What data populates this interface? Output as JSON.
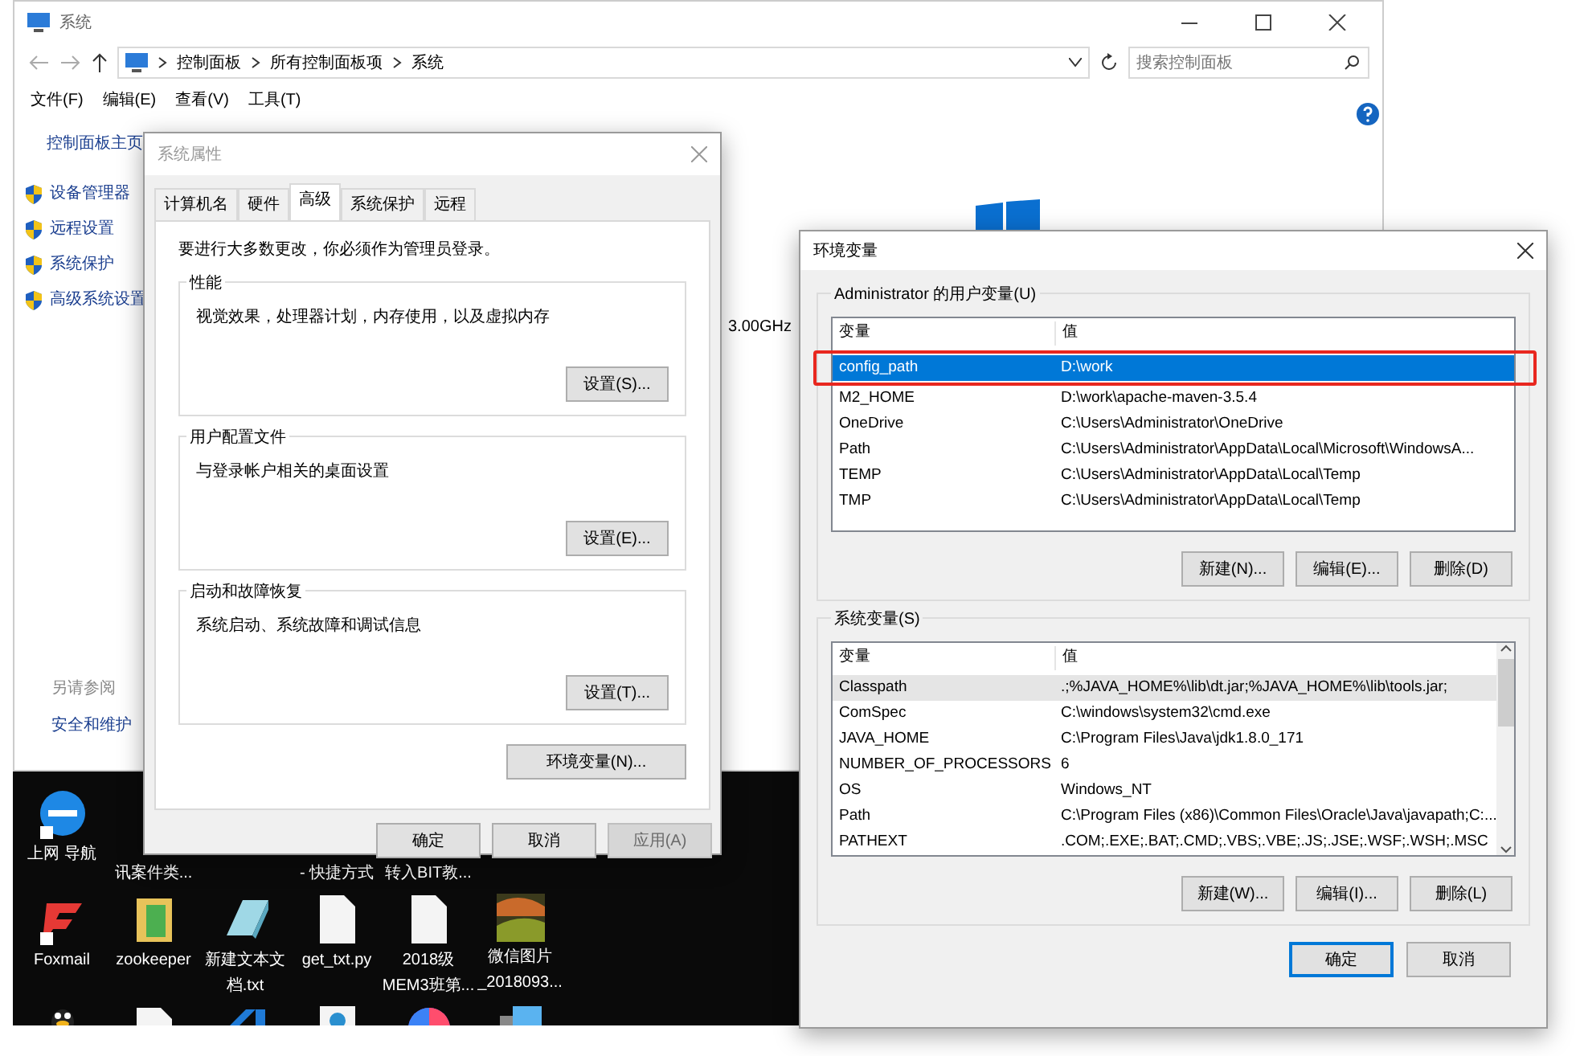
{
  "explorer": {
    "title": "系统",
    "breadcrumb": [
      "控制面板",
      "所有控制面板项",
      "系统"
    ],
    "search": {
      "placeholder": "搜索控制面板"
    },
    "menu": [
      "文件(F)",
      "编辑(E)",
      "查看(V)",
      "工具(T)"
    ],
    "sidebar": {
      "home": "控制面板主页",
      "links": [
        "设备管理器",
        "远程设置",
        "系统保护",
        "高级系统设置"
      ],
      "see_also": "另请参阅",
      "see_also_links": [
        "安全和维护"
      ]
    },
    "fragment": "3.00GHz"
  },
  "system_properties": {
    "title": "系统属性",
    "tabs": [
      {
        "label": "计算机名",
        "selected": false
      },
      {
        "label": "硬件",
        "selected": false
      },
      {
        "label": "高级",
        "selected": true
      },
      {
        "label": "系统保护",
        "selected": false
      },
      {
        "label": "远程",
        "selected": false
      }
    ],
    "notice": "要进行大多数更改，你必须作为管理员登录。",
    "groups": [
      {
        "title": "性能",
        "description": "视觉效果，处理器计划，内存使用，以及虚拟内存",
        "button": "设置(S)..."
      },
      {
        "title": "用户配置文件",
        "description": "与登录帐户相关的桌面设置",
        "button": "设置(E)..."
      },
      {
        "title": "启动和故障恢复",
        "description": "系统启动、系统故障和调试信息",
        "button": "设置(T)..."
      }
    ],
    "env_button": "环境变量(N)...",
    "buttons": [
      {
        "label": "确定",
        "disabled": false
      },
      {
        "label": "取消",
        "disabled": false
      },
      {
        "label": "应用(A)",
        "disabled": true
      }
    ]
  },
  "env_vars": {
    "title": "环境变量",
    "sections": [
      {
        "title": "Administrator 的用户变量(U)",
        "columns": [
          "变量",
          "值"
        ],
        "scrollbar": false,
        "rows": [
          {
            "name": "config_path",
            "value": "D:\\work",
            "selected": true,
            "hovered": false,
            "outlined": true
          },
          {
            "name": "M2_HOME",
            "value": "D:\\work\\apache-maven-3.5.4",
            "selected": false,
            "hovered": false,
            "outlined": false
          },
          {
            "name": "OneDrive",
            "value": "C:\\Users\\Administrator\\OneDrive",
            "selected": false,
            "hovered": false,
            "outlined": false
          },
          {
            "name": "Path",
            "value": "C:\\Users\\Administrator\\AppData\\Local\\Microsoft\\WindowsA...",
            "selected": false,
            "hovered": false,
            "outlined": false
          },
          {
            "name": "TEMP",
            "value": "C:\\Users\\Administrator\\AppData\\Local\\Temp",
            "selected": false,
            "hovered": false,
            "outlined": false
          },
          {
            "name": "TMP",
            "value": "C:\\Users\\Administrator\\AppData\\Local\\Temp",
            "selected": false,
            "hovered": false,
            "outlined": false
          }
        ],
        "buttons": [
          "新建(N)...",
          "编辑(E)...",
          "删除(D)"
        ]
      },
      {
        "title": "系统变量(S)",
        "columns": [
          "变量",
          "值"
        ],
        "scrollbar": true,
        "rows": [
          {
            "name": "Classpath",
            "value": ".;%JAVA_HOME%\\lib\\dt.jar;%JAVA_HOME%\\lib\\tools.jar;",
            "selected": false,
            "hovered": true,
            "outlined": false
          },
          {
            "name": "ComSpec",
            "value": "C:\\windows\\system32\\cmd.exe",
            "selected": false,
            "hovered": false,
            "outlined": false
          },
          {
            "name": "JAVA_HOME",
            "value": "C:\\Program Files\\Java\\jdk1.8.0_171",
            "selected": false,
            "hovered": false,
            "outlined": false
          },
          {
            "name": "NUMBER_OF_PROCESSORS",
            "value": "6",
            "selected": false,
            "hovered": false,
            "outlined": false
          },
          {
            "name": "OS",
            "value": "Windows_NT",
            "selected": false,
            "hovered": false,
            "outlined": false
          },
          {
            "name": "Path",
            "value": "C:\\Program Files (x86)\\Common Files\\Oracle\\Java\\javapath;C:...",
            "selected": false,
            "hovered": false,
            "outlined": false
          },
          {
            "name": "PATHEXT",
            "value": ".COM;.EXE;.BAT;.CMD;.VBS;.VBE;.JS;.JSE;.WSF;.WSH;.MSC",
            "selected": false,
            "hovered": false,
            "outlined": false
          }
        ],
        "buttons": [
          "新建(W)...",
          "编辑(I)...",
          "删除(L)"
        ]
      }
    ],
    "buttons": [
      {
        "label": "确定",
        "default": true
      },
      {
        "label": "取消",
        "default": false
      }
    ]
  },
  "desktop": {
    "rows": [
      [
        {
          "kind": "browser",
          "label": [
            "上网 导航"
          ]
        },
        {
          "label": [
            "讯案件类..."
          ]
        },
        {},
        {
          "label": [
            "- 快捷方式"
          ]
        },
        {
          "label": [
            "转入BIT教..."
          ]
        },
        {}
      ],
      [
        {
          "kind": "mail",
          "label": [
            "Foxmail"
          ]
        },
        {
          "kind": "folder",
          "label": [
            "zookeeper"
          ]
        },
        {
          "kind": "notepad",
          "label": [
            "新建文本文",
            "档.txt"
          ]
        },
        {
          "kind": "file",
          "label": [
            "get_txt.py"
          ]
        },
        {
          "kind": "file",
          "label": [
            "2018级",
            "MEM3班第..."
          ]
        },
        {
          "kind": "image",
          "label": [
            "微信图片",
            "_2018093..."
          ]
        }
      ],
      [
        {
          "kind": "penguin"
        },
        {
          "kind": "file"
        },
        {
          "kind": "code"
        },
        {
          "kind": "web"
        },
        {
          "kind": "color"
        },
        {
          "kind": "monitor"
        }
      ]
    ]
  }
}
